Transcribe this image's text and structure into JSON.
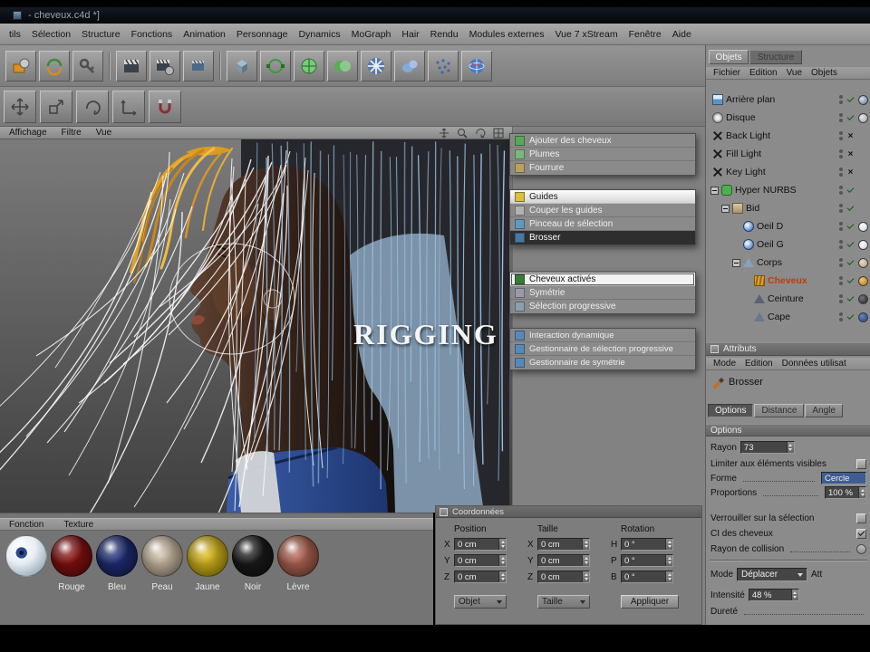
{
  "window": {
    "title": "- cheveux.c4d *]"
  },
  "menu_bar": {
    "items": [
      "tils",
      "Sélection",
      "Structure",
      "Fonctions",
      "Animation",
      "Personnage",
      "Dynamics",
      "MoGraph",
      "Hair",
      "Rendu",
      "Modules externes",
      "Vue 7 xStream",
      "Fenêtre",
      "Aide"
    ]
  },
  "toolbar": {
    "icons": [
      "material-preview",
      "rotate-arrows",
      "animation-key",
      "render-view",
      "render-settings",
      "render-batch",
      "add-cube",
      "add-spline",
      "add-nurbs",
      "add-boole",
      "add-deformer",
      "add-metaball",
      "add-particles",
      "add-sky"
    ]
  },
  "tool_palette": {
    "icons": [
      "move-tool",
      "scale-tool",
      "rotate-tool",
      "axis-lock",
      "snap"
    ]
  },
  "viewport": {
    "menu": [
      "Affichage",
      "Filtre",
      "Vue"
    ],
    "overlay_text": "RIGGING",
    "view_icons": [
      "pan-view",
      "zoom-view",
      "rotate-view",
      "toggle-panels"
    ]
  },
  "context_menu": {
    "items": [
      {
        "label": "Ajouter des cheveux"
      },
      {
        "label": "Plumes"
      },
      {
        "label": "Fourrure"
      },
      {
        "label": "Guides"
      },
      {
        "label": "Couper les guides"
      },
      {
        "label": "Pinceau de sélection"
      },
      {
        "label": "Brosser"
      },
      {
        "label": "Cheveux activés"
      },
      {
        "label": "Symétrie"
      },
      {
        "label": "Sélection progressive"
      },
      {
        "label": "Interaction dynamique"
      },
      {
        "label": "Gestionnaire de sélection progressive"
      },
      {
        "label": "Gestionnaire de symétrie"
      }
    ]
  },
  "objects_panel": {
    "tabs": [
      "Objets",
      "Structure"
    ],
    "menu": [
      "Fichier",
      "Edition",
      "Vue",
      "Objets"
    ],
    "tree": [
      {
        "label": "Arrière plan"
      },
      {
        "label": "Disque"
      },
      {
        "label": "Back Light"
      },
      {
        "label": "Fill Light"
      },
      {
        "label": "Key Light"
      },
      {
        "label": "Hyper NURBS"
      },
      {
        "label": "Bid"
      },
      {
        "label": "Oeil D"
      },
      {
        "label": "Oeil G"
      },
      {
        "label": "Corps"
      },
      {
        "label": "Cheveux"
      },
      {
        "label": "Ceinture"
      },
      {
        "label": "Cape"
      }
    ]
  },
  "attributes_panel": {
    "title": "Attributs",
    "menu": [
      "Mode",
      "Edition",
      "Données utilisat"
    ],
    "tool": "Brosser",
    "tabs": [
      "Options",
      "Distance",
      "Angle"
    ],
    "section": "Options",
    "rayon": {
      "label": "Rayon",
      "value": "73"
    },
    "limiter": {
      "label": "Limiter aux éléments visibles"
    },
    "forme": {
      "label": "Forme",
      "value": "Cercle"
    },
    "proportions": {
      "label": "Proportions",
      "value": "100 %"
    },
    "verrouiller": {
      "label": "Verrouiller sur la sélection"
    },
    "ci": {
      "label": "CI des cheveux"
    },
    "collision": {
      "label": "Rayon de collision"
    },
    "mode": {
      "label": "Mode",
      "value": "Déplacer",
      "extra": "Att"
    },
    "intensite": {
      "label": "Intensité",
      "value": "48 %"
    },
    "durete": {
      "label": "Dureté"
    }
  },
  "materials_panel": {
    "menu": [
      "Fonction",
      "Texture"
    ],
    "materials": [
      {
        "label": "",
        "type": "eye",
        "color": "#e8edf2"
      },
      {
        "label": "Rouge",
        "color": "#8e1010"
      },
      {
        "label": "Bleu",
        "color": "#20307e"
      },
      {
        "label": "Peau",
        "color": "#d8c6ae"
      },
      {
        "label": "Jaune",
        "color": "#e2c11c"
      },
      {
        "label": "Noir",
        "color": "#1b1b1b"
      },
      {
        "label": "Lèvre",
        "color": "#bb6a58"
      }
    ]
  },
  "coordinates_panel": {
    "title": "Coordonnées",
    "columns": [
      "Position",
      "Taille",
      "Rotation"
    ],
    "rows": [
      {
        "p": "X",
        "pv": "0 cm",
        "t": "X",
        "tv": "0 cm",
        "r": "H",
        "rv": "0 °"
      },
      {
        "p": "Y",
        "pv": "0 cm",
        "t": "Y",
        "tv": "0 cm",
        "r": "P",
        "rv": "0 °"
      },
      {
        "p": "Z",
        "pv": "0 cm",
        "t": "Z",
        "tv": "0 cm",
        "r": "B",
        "rv": "0 °"
      }
    ],
    "object_dropdown": "Objet",
    "size_dropdown": "Taille",
    "apply_button": "Appliquer"
  },
  "colors": {
    "selected_object": "#c23a0a",
    "guide_white": "rgba(250,250,250,0.88)",
    "guide_blue": "#9cc3e2",
    "hair_orange": "#e2a21e"
  }
}
